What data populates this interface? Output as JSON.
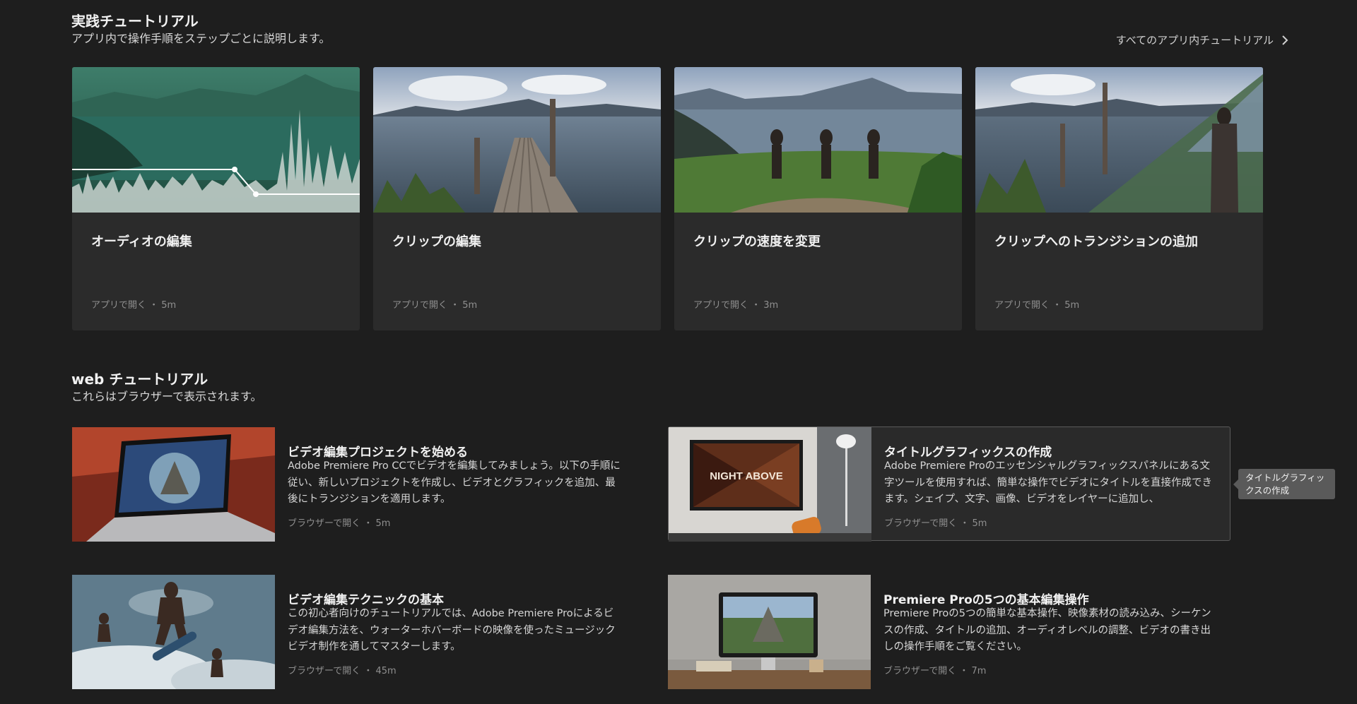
{
  "hands_on": {
    "title": "実践チュートリアル",
    "subtitle": "アプリ内で操作手順をステップごとに説明します。",
    "all_link": "すべてのアプリ内チュートリアル",
    "cards": [
      {
        "title": "オーディオの編集",
        "meta": "アプリで開く ・ 5m"
      },
      {
        "title": "クリップの編集",
        "meta": "アプリで開く ・ 5m"
      },
      {
        "title": "クリップの速度を変更",
        "meta": "アプリで開く ・ 3m"
      },
      {
        "title": "クリップへのトランジションの追加",
        "meta": "アプリで開く ・ 5m"
      }
    ]
  },
  "web": {
    "title": "web チュートリアル",
    "subtitle": "これらはブラウザーで表示されます。",
    "items": [
      {
        "title": "ビデオ編集プロジェクトを始める",
        "desc": "Adobe Premiere Pro CCでビデオを編集してみましょう。以下の手順に従い、新しいプロジェクトを作成し、ビデオとグラフィックを追加、最後にトランジションを適用します。",
        "meta": "ブラウザーで開く ・ 5m"
      },
      {
        "title": "タイトルグラフィックスの作成",
        "desc": "Adobe Premiere Proのエッセンシャルグラフィックスパネルにある文字ツールを使用すれば、簡単な操作でビデオにタイトルを直接作成できます。シェイプ、文字、画像、ビデオをレイヤーに追加し、",
        "meta": "ブラウザーで開く ・ 5m",
        "thumb_text": "NIGHT ABOVE"
      },
      {
        "title": "ビデオ編集テクニックの基本",
        "desc": "この初心者向けのチュートリアルでは、Adobe Premiere Proによるビデオ編集方法を、ウォーターホバーボードの映像を使ったミュージックビデオ制作を通してマスターします。",
        "meta": "ブラウザーで開く ・ 45m"
      },
      {
        "title": "Premiere Proの5つの基本編集操作",
        "desc": "Premiere Proの5つの簡単な基本操作、映像素材の読み込み、シーケンスの作成、タイトルの追加、オーディオレベルの調整、ビデオの書き出しの操作手順をご覧ください。",
        "meta": "ブラウザーで開く ・ 7m"
      }
    ]
  },
  "tooltip": "タイトルグラフィックスの作成",
  "colors": {
    "background": "#1e1e1e",
    "card": "#2b2b2b",
    "meta": "#8f8f8f"
  }
}
